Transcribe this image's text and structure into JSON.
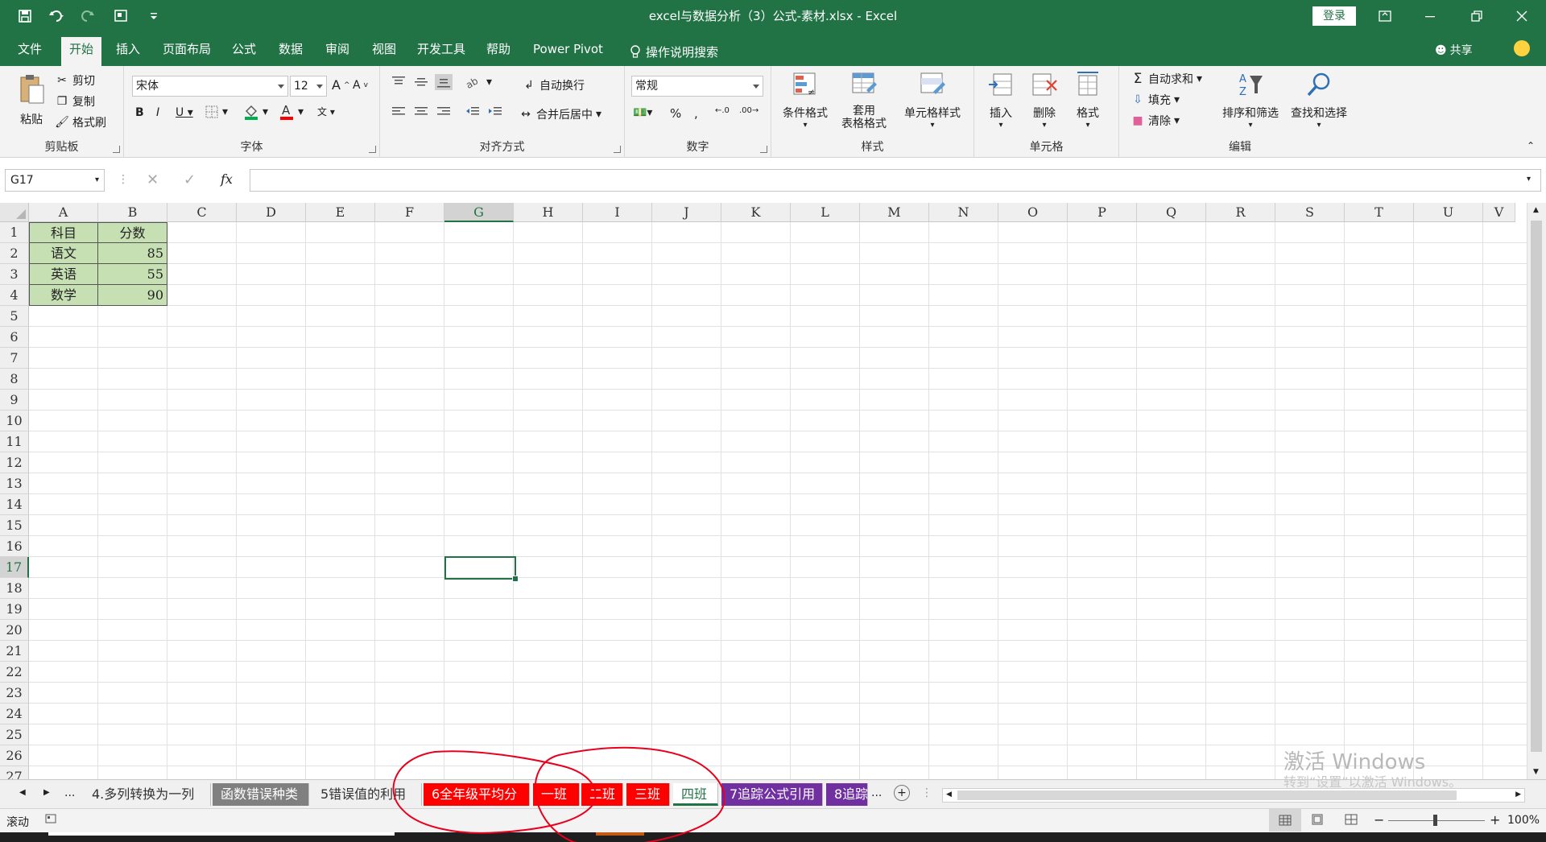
{
  "window": {
    "title": "excel与数据分析（3）公式-素材.xlsx  -  Excel",
    "login": "登录"
  },
  "tabs": [
    "文件",
    "开始",
    "插入",
    "页面布局",
    "公式",
    "数据",
    "审阅",
    "视图",
    "开发工具",
    "帮助",
    "Power Pivot",
    "操作说明搜索"
  ],
  "share": "共享",
  "ribbon": {
    "clipboard": {
      "label": "剪贴板",
      "paste": "粘贴",
      "cut": "剪切",
      "copy": "复制",
      "format_painter": "格式刷"
    },
    "font": {
      "label": "字体",
      "font_name": "宋体",
      "font_size": "12"
    },
    "alignment": {
      "label": "对齐方式",
      "wrap": "自动换行",
      "merge": "合并后居中"
    },
    "number": {
      "label": "数字",
      "format": "常规"
    },
    "styles": {
      "label": "样式",
      "conditional": "条件格式",
      "table_format_1": "套用",
      "table_format_2": "表格格式",
      "cell_styles": "单元格样式"
    },
    "cells": {
      "label": "单元格",
      "insert": "插入",
      "delete": "删除",
      "format": "格式"
    },
    "editing": {
      "label": "编辑",
      "autosum": "自动求和",
      "fill": "填充",
      "clear": "清除",
      "sort_filter": "排序和筛选",
      "find_select": "查找和选择"
    }
  },
  "formula_bar": {
    "name_box": "G17",
    "fx": "fx",
    "formula": ""
  },
  "grid": {
    "columns": [
      "A",
      "B",
      "C",
      "D",
      "E",
      "F",
      "G",
      "H",
      "I",
      "J",
      "K",
      "L",
      "M",
      "N",
      "O",
      "P",
      "Q",
      "R",
      "S",
      "T",
      "U",
      "V"
    ],
    "selected_column": "G",
    "rows": [
      "1",
      "2",
      "3",
      "4",
      "5",
      "6",
      "7",
      "8",
      "9",
      "10",
      "11",
      "12",
      "13",
      "14",
      "15",
      "16",
      "17",
      "18",
      "19",
      "20",
      "21",
      "22",
      "23",
      "24",
      "25",
      "26",
      "27"
    ],
    "selected_row": "17",
    "header": {
      "subject": "科目",
      "score": "分数"
    },
    "data": [
      {
        "subject": "语文",
        "score": "85"
      },
      {
        "subject": "英语",
        "score": "55"
      },
      {
        "subject": "数学",
        "score": "90"
      }
    ]
  },
  "sheets": {
    "ellipsis": "...",
    "tabs": [
      {
        "name": "4.多列转换为一列"
      },
      {
        "name": "函数错误种类"
      },
      {
        "name": "5错误值的利用"
      },
      {
        "name": "6全年级平均分"
      },
      {
        "name": "一班"
      },
      {
        "name": "二班"
      },
      {
        "name": "三班"
      },
      {
        "name": "四班"
      },
      {
        "name": "7追踪公式引用"
      },
      {
        "name": "8追踪"
      }
    ],
    "more": "..."
  },
  "status": {
    "mode": "滚动",
    "zoom": "100%"
  },
  "watermark": {
    "line1": "激活 Windows",
    "line2": "转到“设置”以激活 Windows。"
  },
  "colors": {
    "accent": "#217346",
    "cell_fill": "#c6e0b4",
    "red_tab": "#ff0000",
    "purple_tab": "#7030a0",
    "annotation": "#e8001c"
  }
}
